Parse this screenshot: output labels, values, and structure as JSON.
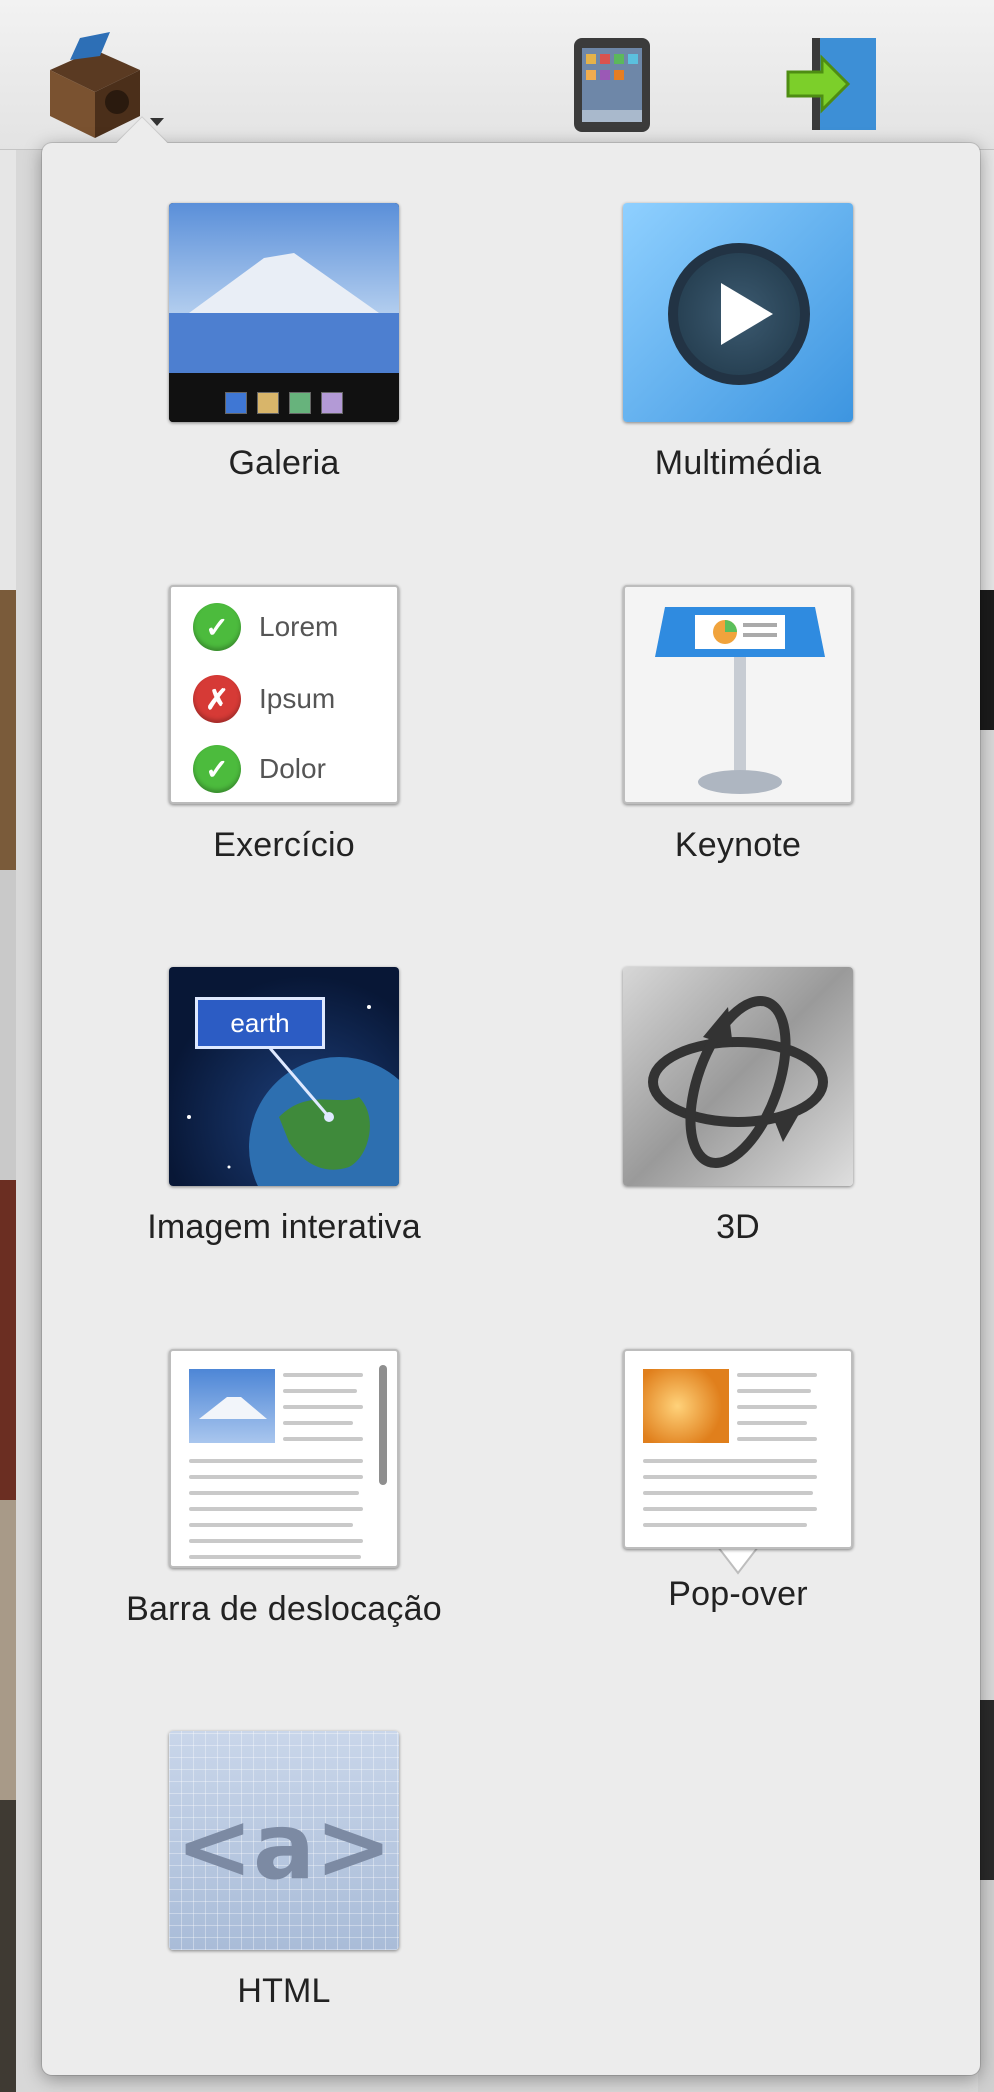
{
  "toolbar": {
    "buttons": [
      {
        "name": "widgets",
        "icon": "widget-box-icon"
      },
      {
        "name": "preview",
        "icon": "ipad-icon"
      },
      {
        "name": "export",
        "icon": "export-arrow-icon"
      }
    ]
  },
  "popover": {
    "items": [
      {
        "id": "galeria",
        "label": "Galeria",
        "icon": "gallery-icon"
      },
      {
        "id": "multimedia",
        "label": "Multimédia",
        "icon": "media-play-icon"
      },
      {
        "id": "exercicio",
        "label": "Exercício",
        "icon": "review-checklist-icon",
        "rows": [
          "Lorem",
          "Ipsum",
          "Dolor"
        ]
      },
      {
        "id": "keynote",
        "label": "Keynote",
        "icon": "keynote-podium-icon"
      },
      {
        "id": "imagem",
        "label": "Imagem interativa",
        "icon": "interactive-image-icon",
        "tag": "earth"
      },
      {
        "id": "3d",
        "label": "3D",
        "icon": "3d-rotate-icon"
      },
      {
        "id": "barra",
        "label": "Barra de deslocação",
        "icon": "scrolling-sidebar-icon"
      },
      {
        "id": "popover",
        "label": "Pop-over",
        "icon": "popover-icon"
      },
      {
        "id": "html",
        "label": "HTML",
        "icon": "html-widget-icon",
        "code": "<a>"
      }
    ]
  },
  "colors": {
    "popover_bg": "#ececec",
    "label_text": "#222222",
    "check_green": "#4cbb3d",
    "cross_red": "#d63a36"
  }
}
